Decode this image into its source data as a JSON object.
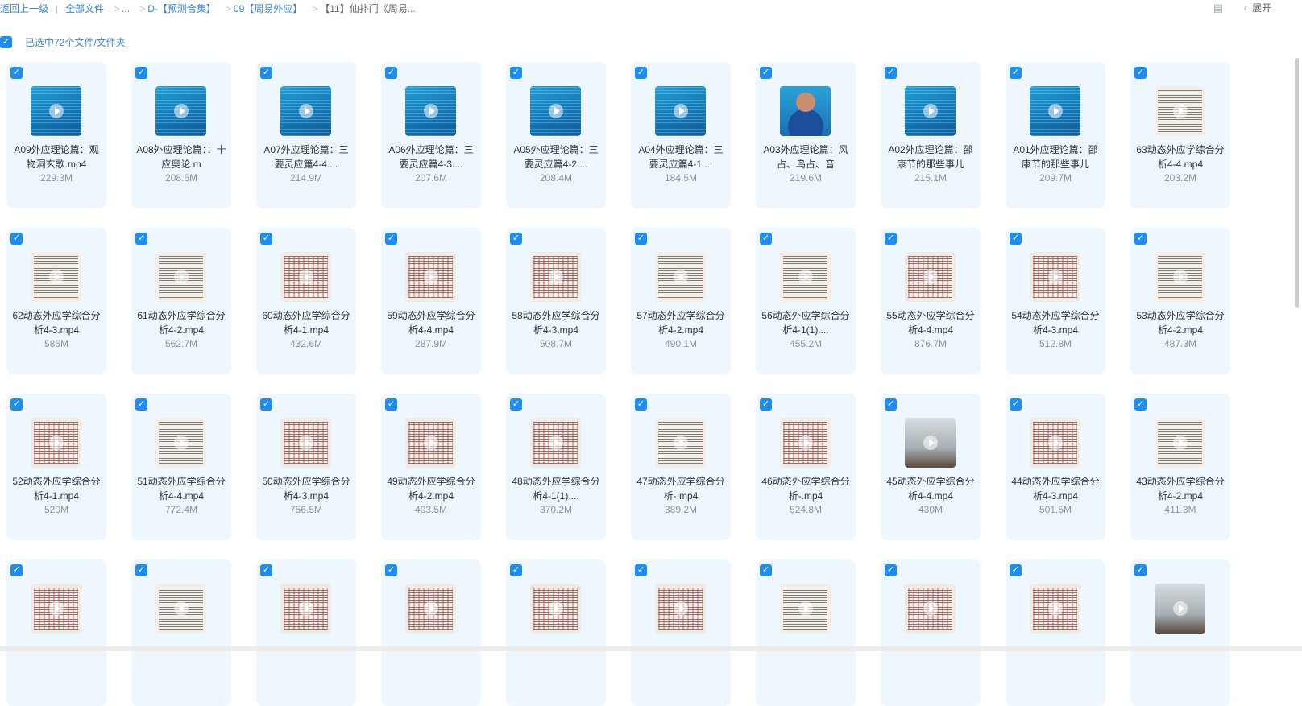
{
  "breadcrumb": {
    "back": "返回上一级",
    "all_files": "全部文件",
    "ellipsis": "...",
    "c1": "D-【预测合集】",
    "c2": "09【周易外应】",
    "current": "【11】仙扑门《周易..."
  },
  "topright": {
    "expand": "展开",
    "list_icon": "list-view-icon",
    "chevron_icon": "chevron-left-icon"
  },
  "selection": {
    "text": "已选中72个文件/文件夹",
    "checked": true
  },
  "colors": {
    "accent": "#1e8cf0",
    "card_bg": "#eef7fe",
    "link": "#3b82d6"
  },
  "files": [
    {
      "name": "A09外应理论篇：观物洞玄歌.mp4",
      "size": "229.3M",
      "thumb": "blue"
    },
    {
      "name": "A08外应理论篇：：十应奥论.m",
      "size": "208.6M",
      "thumb": "blue"
    },
    {
      "name": "A07外应理论篇：三要灵应篇4-4....",
      "size": "214.9M",
      "thumb": "blue"
    },
    {
      "name": "A06外应理论篇：三要灵应篇4-3....",
      "size": "207.6M",
      "thumb": "blue"
    },
    {
      "name": "A05外应理论篇：三要灵应篇4-2....",
      "size": "208.4M",
      "thumb": "blue"
    },
    {
      "name": "A04外应理论篇：三要灵应篇4-1....",
      "size": "184.5M",
      "thumb": "blue"
    },
    {
      "name": "A03外应理论篇：风占、鸟占、音",
      "size": "219.6M",
      "thumb": "person"
    },
    {
      "name": "A02外应理论篇：邵康节的那些事儿",
      "size": "215.1M",
      "thumb": "blue"
    },
    {
      "name": "A01外应理论篇：邵康节的那些事儿",
      "size": "209.7M",
      "thumb": "blue"
    },
    {
      "name": "63动态外应学综合分析4-4.mp4",
      "size": "203.2M",
      "thumb": "paper"
    },
    {
      "name": "62动态外应学综合分析4-3.mp4",
      "size": "586M",
      "thumb": "paper"
    },
    {
      "name": "61动态外应学综合分析4-2.mp4",
      "size": "562.7M",
      "thumb": "paper"
    },
    {
      "name": "60动态外应学综合分析4-1.mp4",
      "size": "432.6M",
      "thumb": "red"
    },
    {
      "name": "59动态外应学综合分析4-4.mp4",
      "size": "287.9M",
      "thumb": "red"
    },
    {
      "name": "58动态外应学综合分析4-3.mp4",
      "size": "508.7M",
      "thumb": "red"
    },
    {
      "name": "57动态外应学综合分析4-2.mp4",
      "size": "490.1M",
      "thumb": "paper"
    },
    {
      "name": "56动态外应学综合分析4-1(1)....",
      "size": "455.2M",
      "thumb": "paper"
    },
    {
      "name": "55动态外应学综合分析4-4.mp4",
      "size": "876.7M",
      "thumb": "red"
    },
    {
      "name": "54动态外应学综合分析4-3.mp4",
      "size": "512.8M",
      "thumb": "red"
    },
    {
      "name": "53动态外应学综合分析4-2.mp4",
      "size": "487.3M",
      "thumb": "paper"
    },
    {
      "name": "52动态外应学综合分析4-1.mp4",
      "size": "520M",
      "thumb": "red"
    },
    {
      "name": "51动态外应学综合分析4-4.mp4",
      "size": "772.4M",
      "thumb": "paper"
    },
    {
      "name": "50动态外应学综合分析4-3.mp4",
      "size": "756.5M",
      "thumb": "red"
    },
    {
      "name": "49动态外应学综合分析4-2.mp4",
      "size": "403.5M",
      "thumb": "red"
    },
    {
      "name": "48动态外应学综合分析4-1(1)....",
      "size": "370.2M",
      "thumb": "red"
    },
    {
      "name": "47动态外应学综合分析-.mp4",
      "size": "389.2M",
      "thumb": "paper"
    },
    {
      "name": "46动态外应学综合分析-.mp4",
      "size": "524.8M",
      "thumb": "red"
    },
    {
      "name": "45动态外应学综合分析4-4.mp4",
      "size": "430M",
      "thumb": "photo"
    },
    {
      "name": "44动态外应学综合分析4-3.mp4",
      "size": "501.5M",
      "thumb": "red"
    },
    {
      "name": "43动态外应学综合分析4-2.mp4",
      "size": "411.3M",
      "thumb": "paper"
    },
    {
      "name": "",
      "size": "",
      "thumb": "red"
    },
    {
      "name": "",
      "size": "",
      "thumb": "paper"
    },
    {
      "name": "",
      "size": "",
      "thumb": "red"
    },
    {
      "name": "",
      "size": "",
      "thumb": "red"
    },
    {
      "name": "",
      "size": "",
      "thumb": "red"
    },
    {
      "name": "",
      "size": "",
      "thumb": "red"
    },
    {
      "name": "",
      "size": "",
      "thumb": "paper"
    },
    {
      "name": "",
      "size": "",
      "thumb": "red"
    },
    {
      "name": "",
      "size": "",
      "thumb": "red"
    },
    {
      "name": "",
      "size": "",
      "thumb": "photo"
    }
  ]
}
